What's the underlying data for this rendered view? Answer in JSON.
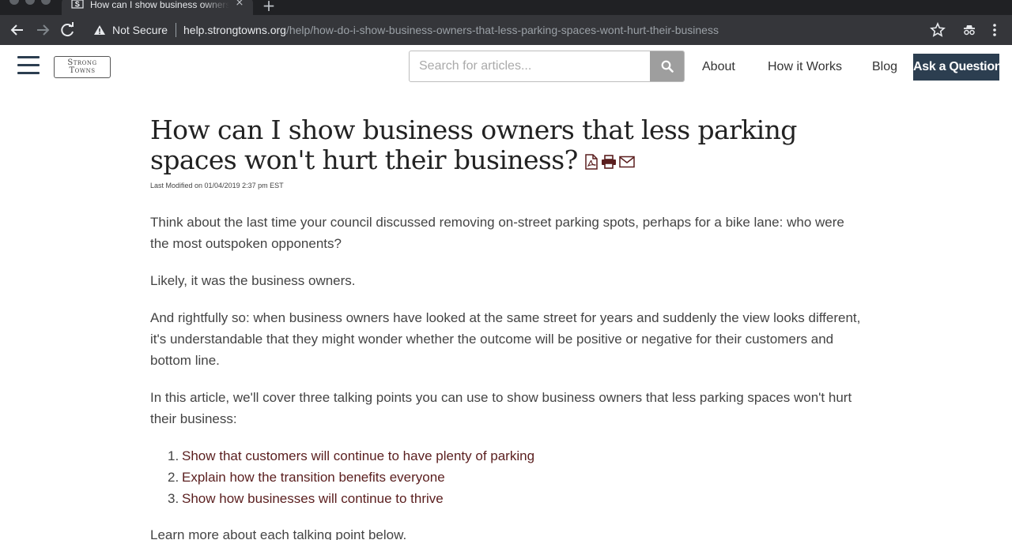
{
  "browser": {
    "tab_title": "How can I show business owners that less parking spaces won't hurt their business",
    "tab_close": "×",
    "new_tab": "+",
    "security_label": "Not Secure",
    "url_host": "help.strongtowns.org",
    "url_path": "/help/how-do-i-show-business-owners-that-less-parking-spaces-wont-hurt-their-business"
  },
  "header": {
    "logo_line1": "Strong",
    "logo_line2": "Towns",
    "search_placeholder": "Search for articles...",
    "nav": [
      {
        "label": "About"
      },
      {
        "label": "How it Works"
      },
      {
        "label": "Blog"
      }
    ],
    "ask_label": "Ask a Question"
  },
  "article": {
    "title": "How can I show business owners that less parking spaces won't hurt their business?",
    "last_modified": "Last Modified on 01/04/2019 2:37 pm EST",
    "paragraphs": [
      "Think about the last time your council discussed removing on-street parking spots, perhaps for a bike lane: who were the most outspoken opponents?",
      "Likely, it was the business owners.",
      "And rightfully so: when business owners have looked at the same street for years and suddenly the view looks different, it's understandable that they might wonder whether the outcome will be positive or negative for their customers and bottom line.",
      "In this article, we'll cover three talking points you can use to show business owners that less parking spaces won't hurt their business:"
    ],
    "talking_points": [
      {
        "num": "1.",
        "text": "Show that customers will continue to have plenty of parking"
      },
      {
        "num": "2.",
        "text": "Explain how the transition benefits everyone"
      },
      {
        "num": "3.",
        "text": "Show how businesses will continue to thrive"
      }
    ],
    "closing": "Learn more about each talking point below."
  },
  "colors": {
    "header_dark": "#2c3e50",
    "link_color": "#5a1e1e",
    "body_text": "#444444"
  }
}
